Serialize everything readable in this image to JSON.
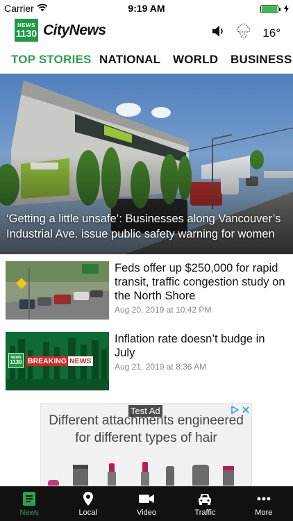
{
  "status_bar": {
    "carrier": "Carrier",
    "time": "9:19 AM"
  },
  "header": {
    "logo_news_line1": "NEWS",
    "logo_news_line2": "1130",
    "logo_brand": "CityNews",
    "temperature": "16°",
    "icons": [
      "speaker-icon",
      "cloud-rain-icon"
    ]
  },
  "tabs": [
    {
      "label": "TOP STORIES",
      "active": true
    },
    {
      "label": "NATIONAL",
      "active": false
    },
    {
      "label": "WORLD",
      "active": false
    },
    {
      "label": "BUSINESS",
      "active": false
    }
  ],
  "hero": {
    "title": "‘Getting a little unsafe’: Businesses along Vancouver’s Industrial Ave. issue public safety warning for women"
  },
  "stories": [
    {
      "title": "Feds offer up $250,000 for rapid transit, traffic congestion study on the North Shore",
      "date": "Aug 20, 2019 at 10:42 PM"
    },
    {
      "title": "Inflation rate doesn’t budge in July",
      "date": "Aug 21, 2019 at 8:36 AM",
      "thumb_logo_line1": "NEWS",
      "thumb_logo_line2": "1130",
      "thumb_banner_left": "BREAKING",
      "thumb_banner_right": "NEWS"
    }
  ],
  "ad": {
    "label": "Test Ad",
    "headline_line1": "Different attachments engineered",
    "headline_line2": "for different types of hair"
  },
  "bottom_nav": [
    {
      "label": "News",
      "icon": "news-icon",
      "active": true
    },
    {
      "label": "Local",
      "icon": "location-pin-icon",
      "active": false
    },
    {
      "label": "Video",
      "icon": "video-camera-icon",
      "active": false
    },
    {
      "label": "Traffic",
      "icon": "car-icon",
      "active": false
    },
    {
      "label": "More",
      "icon": "more-dots-icon",
      "active": false
    }
  ],
  "colors": {
    "accent": "#2aa34f",
    "nav_bg": "#111111",
    "date_gray": "#8a8a8a"
  }
}
